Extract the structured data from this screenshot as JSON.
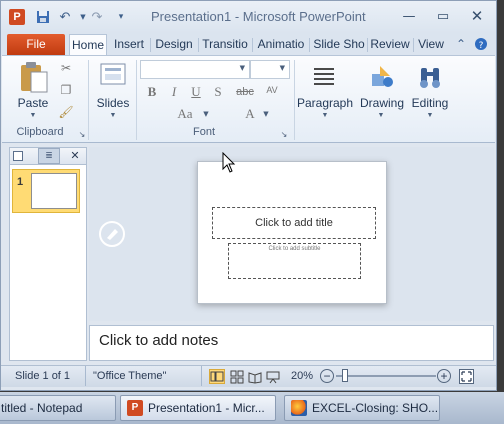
{
  "window": {
    "title": "Presentation1  -  Microsoft PowerPoint",
    "app_badge": "P",
    "accent": "#d04a21"
  },
  "quick_access": [
    "save-icon",
    "undo-icon",
    "redo-icon",
    "customize-icon"
  ],
  "ribbon_tabs": {
    "file": "File",
    "items": [
      "Home",
      "Insert",
      "Design",
      "Transitio",
      "Animatio",
      "Slide Sho",
      "Review",
      "View"
    ],
    "active": "Home"
  },
  "ribbon": {
    "paste": "Paste",
    "slides": "Slides",
    "clipboard": "Clipboard",
    "font": "Font",
    "paragraph": "Paragraph",
    "drawing": "Drawing",
    "editing": "Editing",
    "font_buttons": [
      "B",
      "I",
      "U",
      "S",
      "abc",
      "AV",
      "Aa"
    ]
  },
  "thumbnails": {
    "slide_number": "1"
  },
  "slide": {
    "title_placeholder": "Click to add title",
    "subtitle_placeholder": "Click to add subtitle"
  },
  "notes": {
    "placeholder": "Click to add notes"
  },
  "status": {
    "slide_info": "Slide 1 of 1",
    "theme": "\"Office Theme\"",
    "zoom": "20%"
  },
  "taskbar": {
    "items": [
      {
        "label": "titled - Notepad",
        "icon": "notepad-icon"
      },
      {
        "label": "Presentation1 - Micr...",
        "icon": "powerpoint-icon"
      },
      {
        "label": "EXCEL-Closing: SHO...",
        "icon": "firefox-icon"
      }
    ]
  }
}
